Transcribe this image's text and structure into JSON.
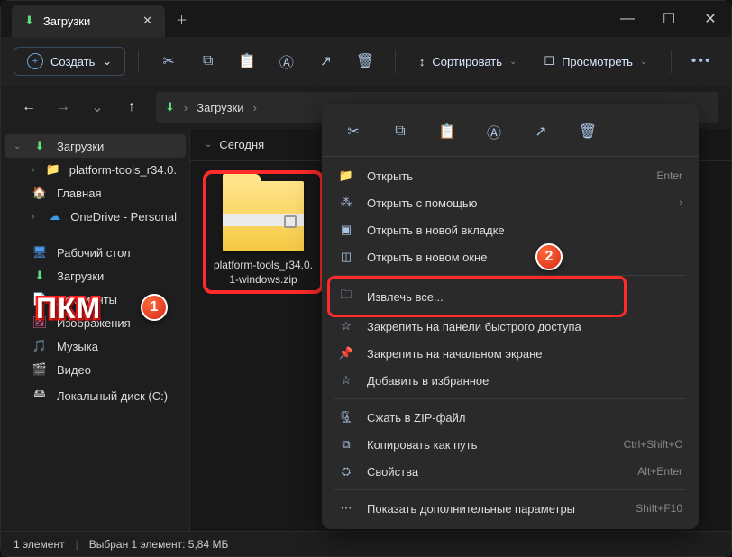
{
  "tab": {
    "title": "Загрузки"
  },
  "toolbar": {
    "new_label": "Создать",
    "sort_label": "Сортировать",
    "view_label": "Просмотреть"
  },
  "address": {
    "folder": "Загрузки"
  },
  "sidebar": {
    "downloads": "Загрузки",
    "platform_tools": "platform-tools_r34.0.",
    "home": "Главная",
    "onedrive": "OneDrive - Personal",
    "desktop": "Рабочий стол",
    "downloads2": "Загрузки",
    "documents": "Документы",
    "pictures": "Изображения",
    "music": "Музыка",
    "videos": "Видео",
    "localdisk": "Локальный диск (C:)"
  },
  "content": {
    "group_today": "Сегодня",
    "file_label": "platform-tools_r34.0.\n1-windows.zip"
  },
  "context": {
    "open": "Открыть",
    "open_shortcut": "Enter",
    "open_with": "Открыть с помощью",
    "open_tab": "Открыть в новой вкладке",
    "open_window": "Открыть в новом окне",
    "extract_all": "Извлечь все...",
    "pin_quick": "Закрепить на панели быстрого доступа",
    "pin_start": "Закрепить на начальном экране",
    "add_fav": "Добавить в избранное",
    "compress": "Сжать в ZIP-файл",
    "copy_path": "Копировать как путь",
    "copy_path_shortcut": "Ctrl+Shift+C",
    "properties": "Свойства",
    "properties_shortcut": "Alt+Enter",
    "show_more": "Показать дополнительные параметры",
    "show_more_shortcut": "Shift+F10"
  },
  "statusbar": {
    "count": "1 элемент",
    "selected": "Выбран 1 элемент: 5,84 МБ"
  },
  "annotations": {
    "pkm": "ПКМ",
    "one": "1",
    "two": "2"
  }
}
